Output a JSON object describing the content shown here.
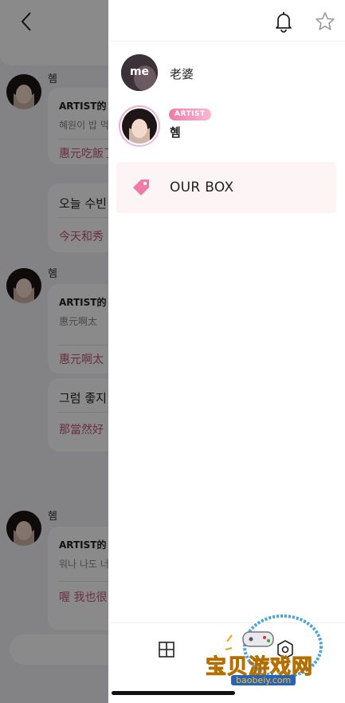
{
  "chat": {
    "groups": [
      {
        "name": "혬",
        "bubble1": {
          "title": "ARTIST的",
          "sub": "혜원이 밥 먹",
          "translation": "惠元吃飯了"
        },
        "bubble2": {
          "text": "오늘 수빈",
          "translation": "今天和秀"
        }
      },
      {
        "name": "혬",
        "bubble1": {
          "title": "ARTIST的",
          "sub": "惠元啊太",
          "translation": "惠元啊太"
        },
        "bubble2": {
          "text": "그럼 좋지",
          "translation": "那當然好"
        }
      },
      {
        "name": "혬",
        "bubble1": {
          "title": "ARTIST的",
          "sub": "워나 나도 너",
          "translation": "喔 我也很"
        }
      }
    ]
  },
  "drawer": {
    "members": [
      {
        "avatar_text": "me",
        "name": "老婆"
      },
      {
        "badge": "ARTIST",
        "name": "혬"
      }
    ],
    "ourbox_label": "OUR BOX"
  },
  "watermark": {
    "text": "宝贝游戏网",
    "url": "baobeiy.com"
  },
  "colors": {
    "accent_pink": "#f07aa6",
    "translation_pink": "#c4577a",
    "ourbox_bg": "#fdf4f6"
  },
  "icons": [
    "back-chevron-icon",
    "bell-icon",
    "star-icon",
    "tag-icon",
    "grid-icon",
    "gear-icon"
  ]
}
